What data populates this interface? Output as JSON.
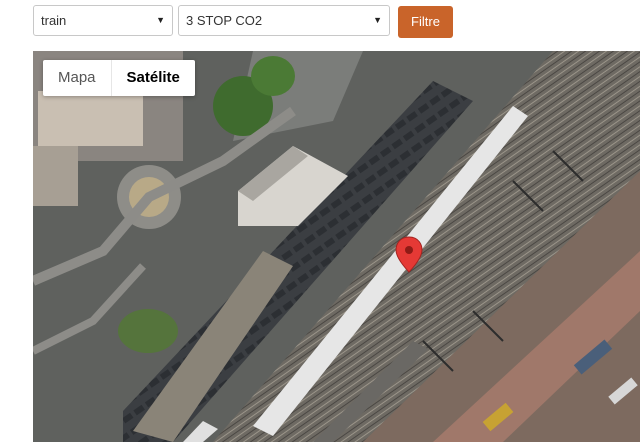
{
  "filters": {
    "mode_value": "train",
    "stop_value": "3 STOP CO2",
    "submit_label": "Filtre",
    "caret_icon": "caret-down-icon"
  },
  "map": {
    "type_buttons": {
      "map_label": "Mapa",
      "satellite_label": "Satélite",
      "active": "satellite"
    },
    "marker_icon": "map-pin-icon",
    "marker_color": "#e53935"
  },
  "colors": {
    "accent": "#c9642a"
  }
}
